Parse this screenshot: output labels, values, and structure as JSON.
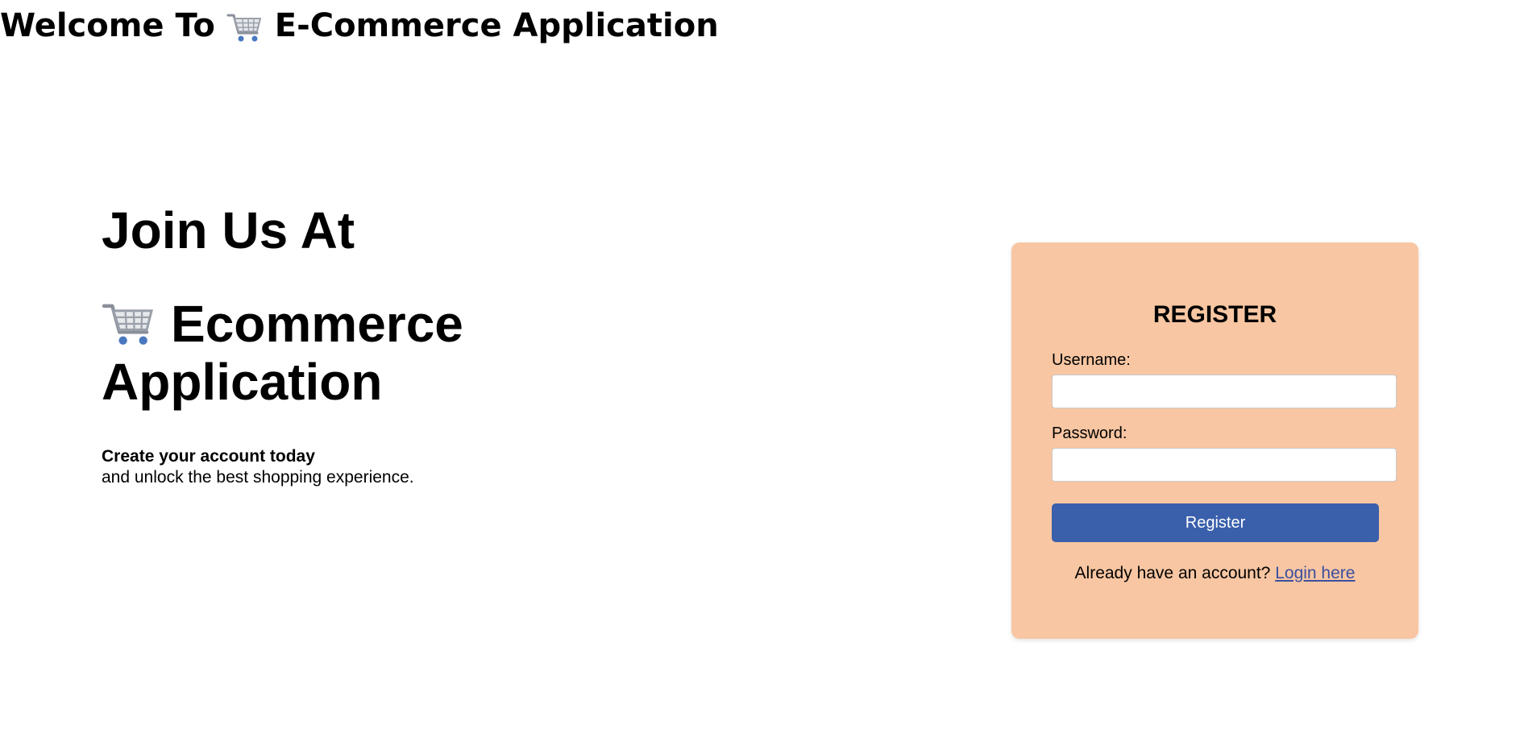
{
  "header": {
    "title_prefix": "Welcome To",
    "title_suffix": "E-Commerce Application",
    "title_icon": "shopping-cart-icon"
  },
  "hero": {
    "line1": "Join Us At",
    "line2": "Ecommerce",
    "line3": "Application",
    "icon": "shopping-cart-icon",
    "tagline_bold": "Create your account today",
    "tagline": "and unlock the best shopping experience."
  },
  "register_form": {
    "title": "REGISTER",
    "username_label": "Username:",
    "username_value": "",
    "password_label": "Password:",
    "password_value": "",
    "submit_label": "Register",
    "login_prompt": "Already have an account?",
    "login_link": "Login here"
  },
  "colors": {
    "card_background": "#f8c6a2",
    "button_background": "#3a5fab",
    "link": "#3b4fa0"
  }
}
